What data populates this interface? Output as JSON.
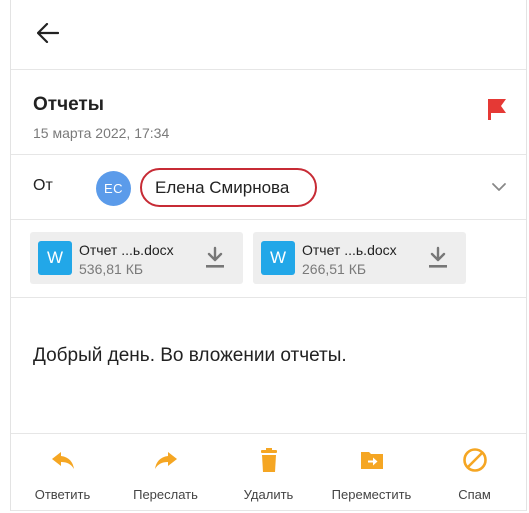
{
  "header": {
    "back_icon": "arrow-left-icon",
    "subject": "Отчеты",
    "date": "15 марта 2022, 17:34",
    "flag_icon": "flag-icon",
    "flag_color": "#e53935"
  },
  "from": {
    "label": "От",
    "avatar_initials": "EC",
    "avatar_color": "#5b9bea",
    "sender_name": "Елена Смирнова",
    "highlight_color": "#c72b35",
    "expand_icon": "chevron-down-icon"
  },
  "attachments": [
    {
      "icon_letter": "W",
      "name": "Отчет ...ь.docx",
      "size": "536,81 КБ",
      "download_icon": "download-icon"
    },
    {
      "icon_letter": "W",
      "name": "Отчет ...ь.docx",
      "size": "266,51 КБ",
      "download_icon": "download-icon"
    }
  ],
  "body": {
    "text": "Добрый день. Во вложении отчеты."
  },
  "toolbar": {
    "accent_color": "#f5a623",
    "items": [
      {
        "label": "Ответить",
        "icon": "reply-icon"
      },
      {
        "label": "Переслать",
        "icon": "forward-icon"
      },
      {
        "label": "Удалить",
        "icon": "trash-icon"
      },
      {
        "label": "Переместить",
        "icon": "move-folder-icon"
      },
      {
        "label": "Спам",
        "icon": "spam-icon"
      }
    ]
  }
}
